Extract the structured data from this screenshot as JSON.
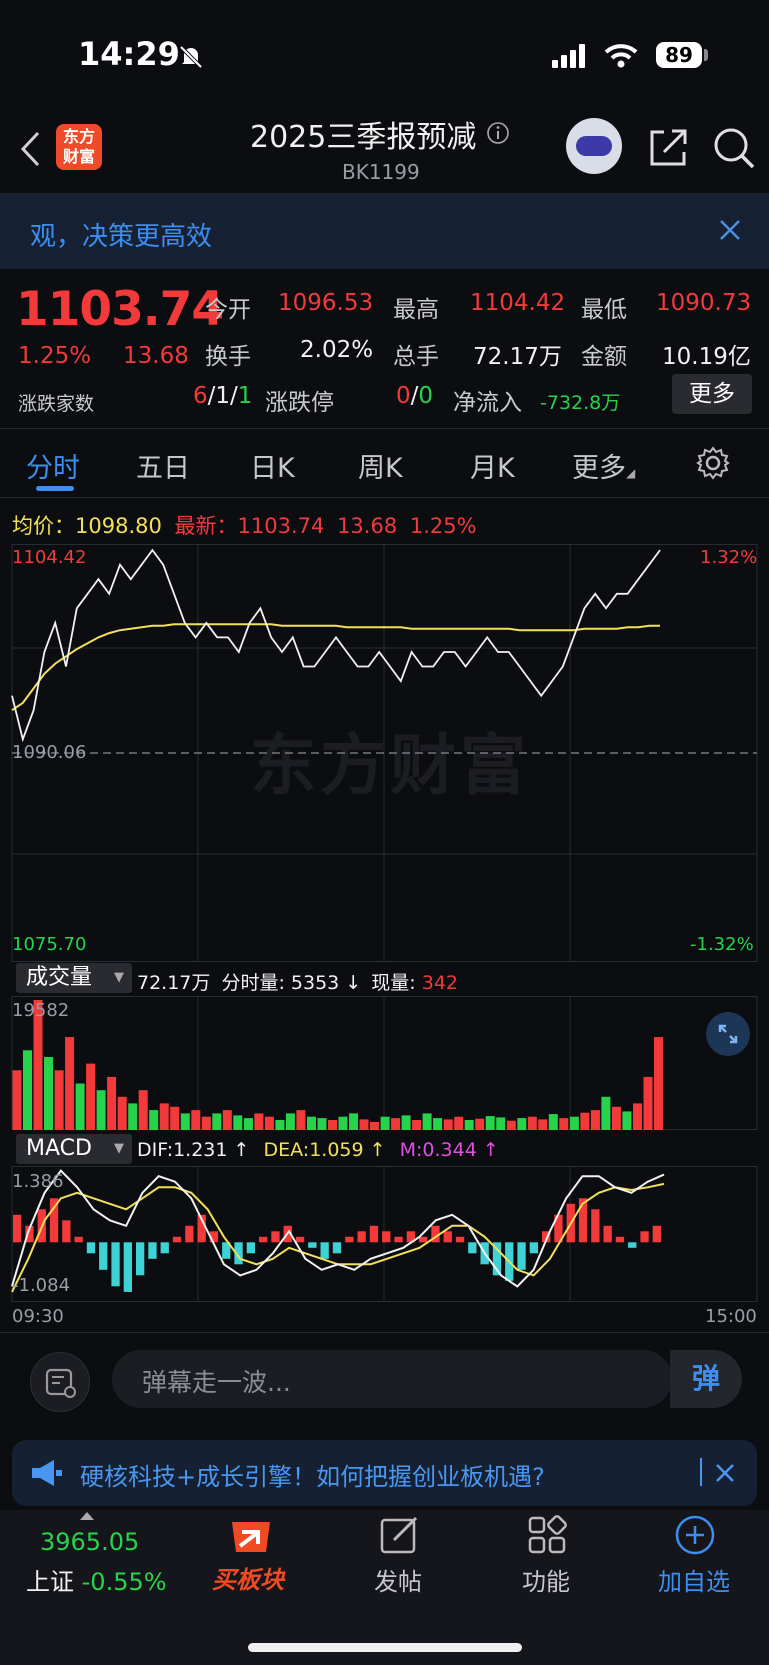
{
  "status_bar": {
    "time": "14:29",
    "battery": "89"
  },
  "header": {
    "title": "2025三季报预减",
    "code": "BK1199",
    "logo_text": "东方财富"
  },
  "banner": {
    "text": "观，决策更高效"
  },
  "quote": {
    "price": "1103.74",
    "change_pct": "1.25%",
    "change": "13.68",
    "open_label": "今开",
    "open": "1096.53",
    "high_label": "最高",
    "high": "1104.42",
    "low_label": "最低",
    "low": "1090.73",
    "turnover_label": "换手",
    "turnover": "2.02%",
    "volume_label": "总手",
    "volume": "72.17万",
    "amount_label": "金额",
    "amount": "10.19亿",
    "breadth_label": "涨跌家数",
    "up": "6",
    "flat": "1",
    "down": "1",
    "limit_label": "涨跌停",
    "limit_up": "0",
    "limit_down": "0",
    "netflow_label": "净流入",
    "netflow": "-732.8万",
    "more": "更多"
  },
  "tabs": [
    "分时",
    "五日",
    "日K",
    "周K",
    "月K",
    "更多"
  ],
  "info_line": {
    "avg_label": "均价：",
    "avg": "1098.80",
    "latest_label": "最新：",
    "latest": "1103.74",
    "chg": "13.68",
    "pct": "1.25%"
  },
  "chart_data": [
    {
      "type": "line",
      "title": "",
      "ylim": [
        1075.7,
        1104.42
      ],
      "y_ticks": [
        "1104.42",
        "1090.06",
        "1075.70"
      ],
      "pct_ticks": [
        "1.32%",
        "-1.32%"
      ],
      "prev_close": 1090.06,
      "series": [
        {
          "name": "",
          "y": [
            1094,
            1091,
            1093,
            1097,
            1099,
            1096,
            1100,
            1101,
            1102,
            1101,
            1103,
            1102,
            1103,
            1104,
            1103,
            1101,
            1099,
            1098,
            1099,
            1098,
            1098,
            1097,
            1099,
            1100,
            1098,
            1097,
            1098,
            1096,
            1096,
            1097,
            1098,
            1097,
            1096,
            1096,
            1097,
            1096,
            1095,
            1097,
            1096,
            1096,
            1097,
            1097,
            1096,
            1097,
            1098,
            1097,
            1097,
            1096,
            1095,
            1094,
            1095,
            1096,
            1098,
            1100,
            1101,
            1100,
            1101,
            1101,
            1102,
            1103,
            1104
          ]
        },
        {
          "name": "",
          "y": [
            1093,
            1093.5,
            1094.5,
            1095.5,
            1096.2,
            1096.7,
            1097.2,
            1097.6,
            1098,
            1098.3,
            1098.5,
            1098.6,
            1098.7,
            1098.8,
            1098.8,
            1098.9,
            1098.9,
            1098.9,
            1098.9,
            1098.9,
            1098.9,
            1098.9,
            1098.9,
            1098.9,
            1098.9,
            1098.8,
            1098.8,
            1098.8,
            1098.8,
            1098.8,
            1098.8,
            1098.7,
            1098.7,
            1098.7,
            1098.7,
            1098.7,
            1098.7,
            1098.6,
            1098.6,
            1098.6,
            1098.6,
            1098.6,
            1098.6,
            1098.6,
            1098.6,
            1098.6,
            1098.6,
            1098.5,
            1098.5,
            1098.5,
            1098.5,
            1098.5,
            1098.5,
            1098.6,
            1098.6,
            1098.6,
            1098.6,
            1098.7,
            1098.7,
            1098.8,
            1098.8
          ]
        }
      ]
    },
    {
      "type": "bar",
      "title": "",
      "ymax": 19582,
      "y_ticks": [
        "19582"
      ],
      "values": [
        9000,
        12000,
        19582,
        11000,
        9000,
        14000,
        7000,
        10000,
        6000,
        8000,
        5000,
        4000,
        6000,
        3000,
        4000,
        3500,
        2500,
        3000,
        2000,
        2500,
        3000,
        2200,
        1800,
        2500,
        2000,
        1500,
        2500,
        3000,
        2000,
        1800,
        1500,
        2000,
        2500,
        1600,
        1200,
        2000,
        1800,
        2200,
        1500,
        2500,
        1800,
        1600,
        2000,
        1500,
        1700,
        2100,
        1900,
        1400,
        1800,
        2000,
        1600,
        2400,
        1800,
        2000,
        2600,
        3000,
        5000,
        3500,
        2800,
        4000,
        8000,
        14000
      ],
      "up": [
        1,
        0,
        1,
        0,
        1,
        1,
        0,
        1,
        0,
        1,
        1,
        0,
        1,
        0,
        1,
        1,
        0,
        1,
        1,
        0,
        1,
        0,
        0,
        1,
        1,
        0,
        0,
        1,
        0,
        0,
        1,
        0,
        0,
        1,
        1,
        0,
        1,
        0,
        1,
        0,
        0,
        1,
        1,
        0,
        1,
        0,
        0,
        1,
        0,
        1,
        1,
        0,
        1,
        0,
        1,
        1,
        0,
        1,
        0,
        1,
        1,
        1
      ]
    },
    {
      "type": "bar",
      "title": "",
      "ylim": [
        -1.084,
        1.386
      ],
      "y_ticks": [
        "1.386",
        "-1.084"
      ],
      "x_ticks": [
        "09:30",
        "15:00"
      ],
      "macd": [
        0.5,
        0.3,
        0.6,
        0.8,
        0.4,
        0.1,
        -0.2,
        -0.5,
        -0.8,
        -0.9,
        -0.6,
        -0.3,
        -0.2,
        0.1,
        0.3,
        0.5,
        0.2,
        -0.3,
        -0.4,
        -0.2,
        0.1,
        0.2,
        0.3,
        0.1,
        -0.1,
        -0.3,
        -0.2,
        0.1,
        0.2,
        0.3,
        0.2,
        0.1,
        0.2,
        0.1,
        0.3,
        0.2,
        0.1,
        -0.2,
        -0.4,
        -0.6,
        -0.7,
        -0.5,
        -0.2,
        0.2,
        0.5,
        0.7,
        0.8,
        0.6,
        0.3,
        0.1,
        -0.1,
        0.2,
        0.3
      ],
      "series": [
        {
          "name": "DIF",
          "y": [
            -0.8,
            0.2,
            0.9,
            1.3,
            1.0,
            0.6,
            0.4,
            0.3,
            0.9,
            1.2,
            1.1,
            0.8,
            0.2,
            -0.4,
            -0.6,
            -0.5,
            -0.2,
            0.2,
            -0.3,
            -0.5,
            -0.4,
            -0.5,
            -0.3,
            -0.2,
            -0.1,
            0.1,
            0.4,
            0.5,
            0.3,
            -0.2,
            -0.6,
            -0.8,
            -0.5,
            0.2,
            0.8,
            1.2,
            1.2,
            1.0,
            0.9,
            1.1,
            1.23
          ]
        },
        {
          "name": "DEA",
          "y": [
            -0.9,
            -0.3,
            0.4,
            0.8,
            0.9,
            0.8,
            0.7,
            0.6,
            0.8,
            1.0,
            1.0,
            0.9,
            0.6,
            0.1,
            -0.3,
            -0.4,
            -0.3,
            -0.1,
            -0.2,
            -0.3,
            -0.4,
            -0.4,
            -0.4,
            -0.3,
            -0.2,
            -0.1,
            0.1,
            0.3,
            0.3,
            0.1,
            -0.2,
            -0.5,
            -0.6,
            -0.3,
            0.2,
            0.7,
            0.9,
            1.0,
            0.95,
            1.0,
            1.06
          ]
        }
      ]
    }
  ],
  "volume_bar": {
    "label": "成交量",
    "total": "72.17万",
    "minute_label": "分时量:",
    "minute": "5353",
    "arrow": "↓",
    "now_label": "现量:",
    "now": "342"
  },
  "macd_bar": {
    "label": "MACD",
    "dif": "DIF:1.231 ↑",
    "dea": "DEA:1.059 ↑",
    "m": "M:0.344 ↑"
  },
  "comment": {
    "placeholder": "弹幕走一波...",
    "btn": "弹"
  },
  "news": {
    "text": "硬核科技+成长引擎！如何把握创业板机遇?"
  },
  "bottom_nav": {
    "index_value": "3965.05",
    "index_name": "上证",
    "index_pct": "-0.55%",
    "buy": "买板块",
    "post": "发帖",
    "func": "功能",
    "add": "加自选"
  },
  "colors": {
    "up": "#f23a3a",
    "down": "#27d34a",
    "accent": "#3d8ef0",
    "avg_line": "#f3e05a",
    "macd_neg": "#3fd2d4",
    "m_value": "#e050e0"
  }
}
